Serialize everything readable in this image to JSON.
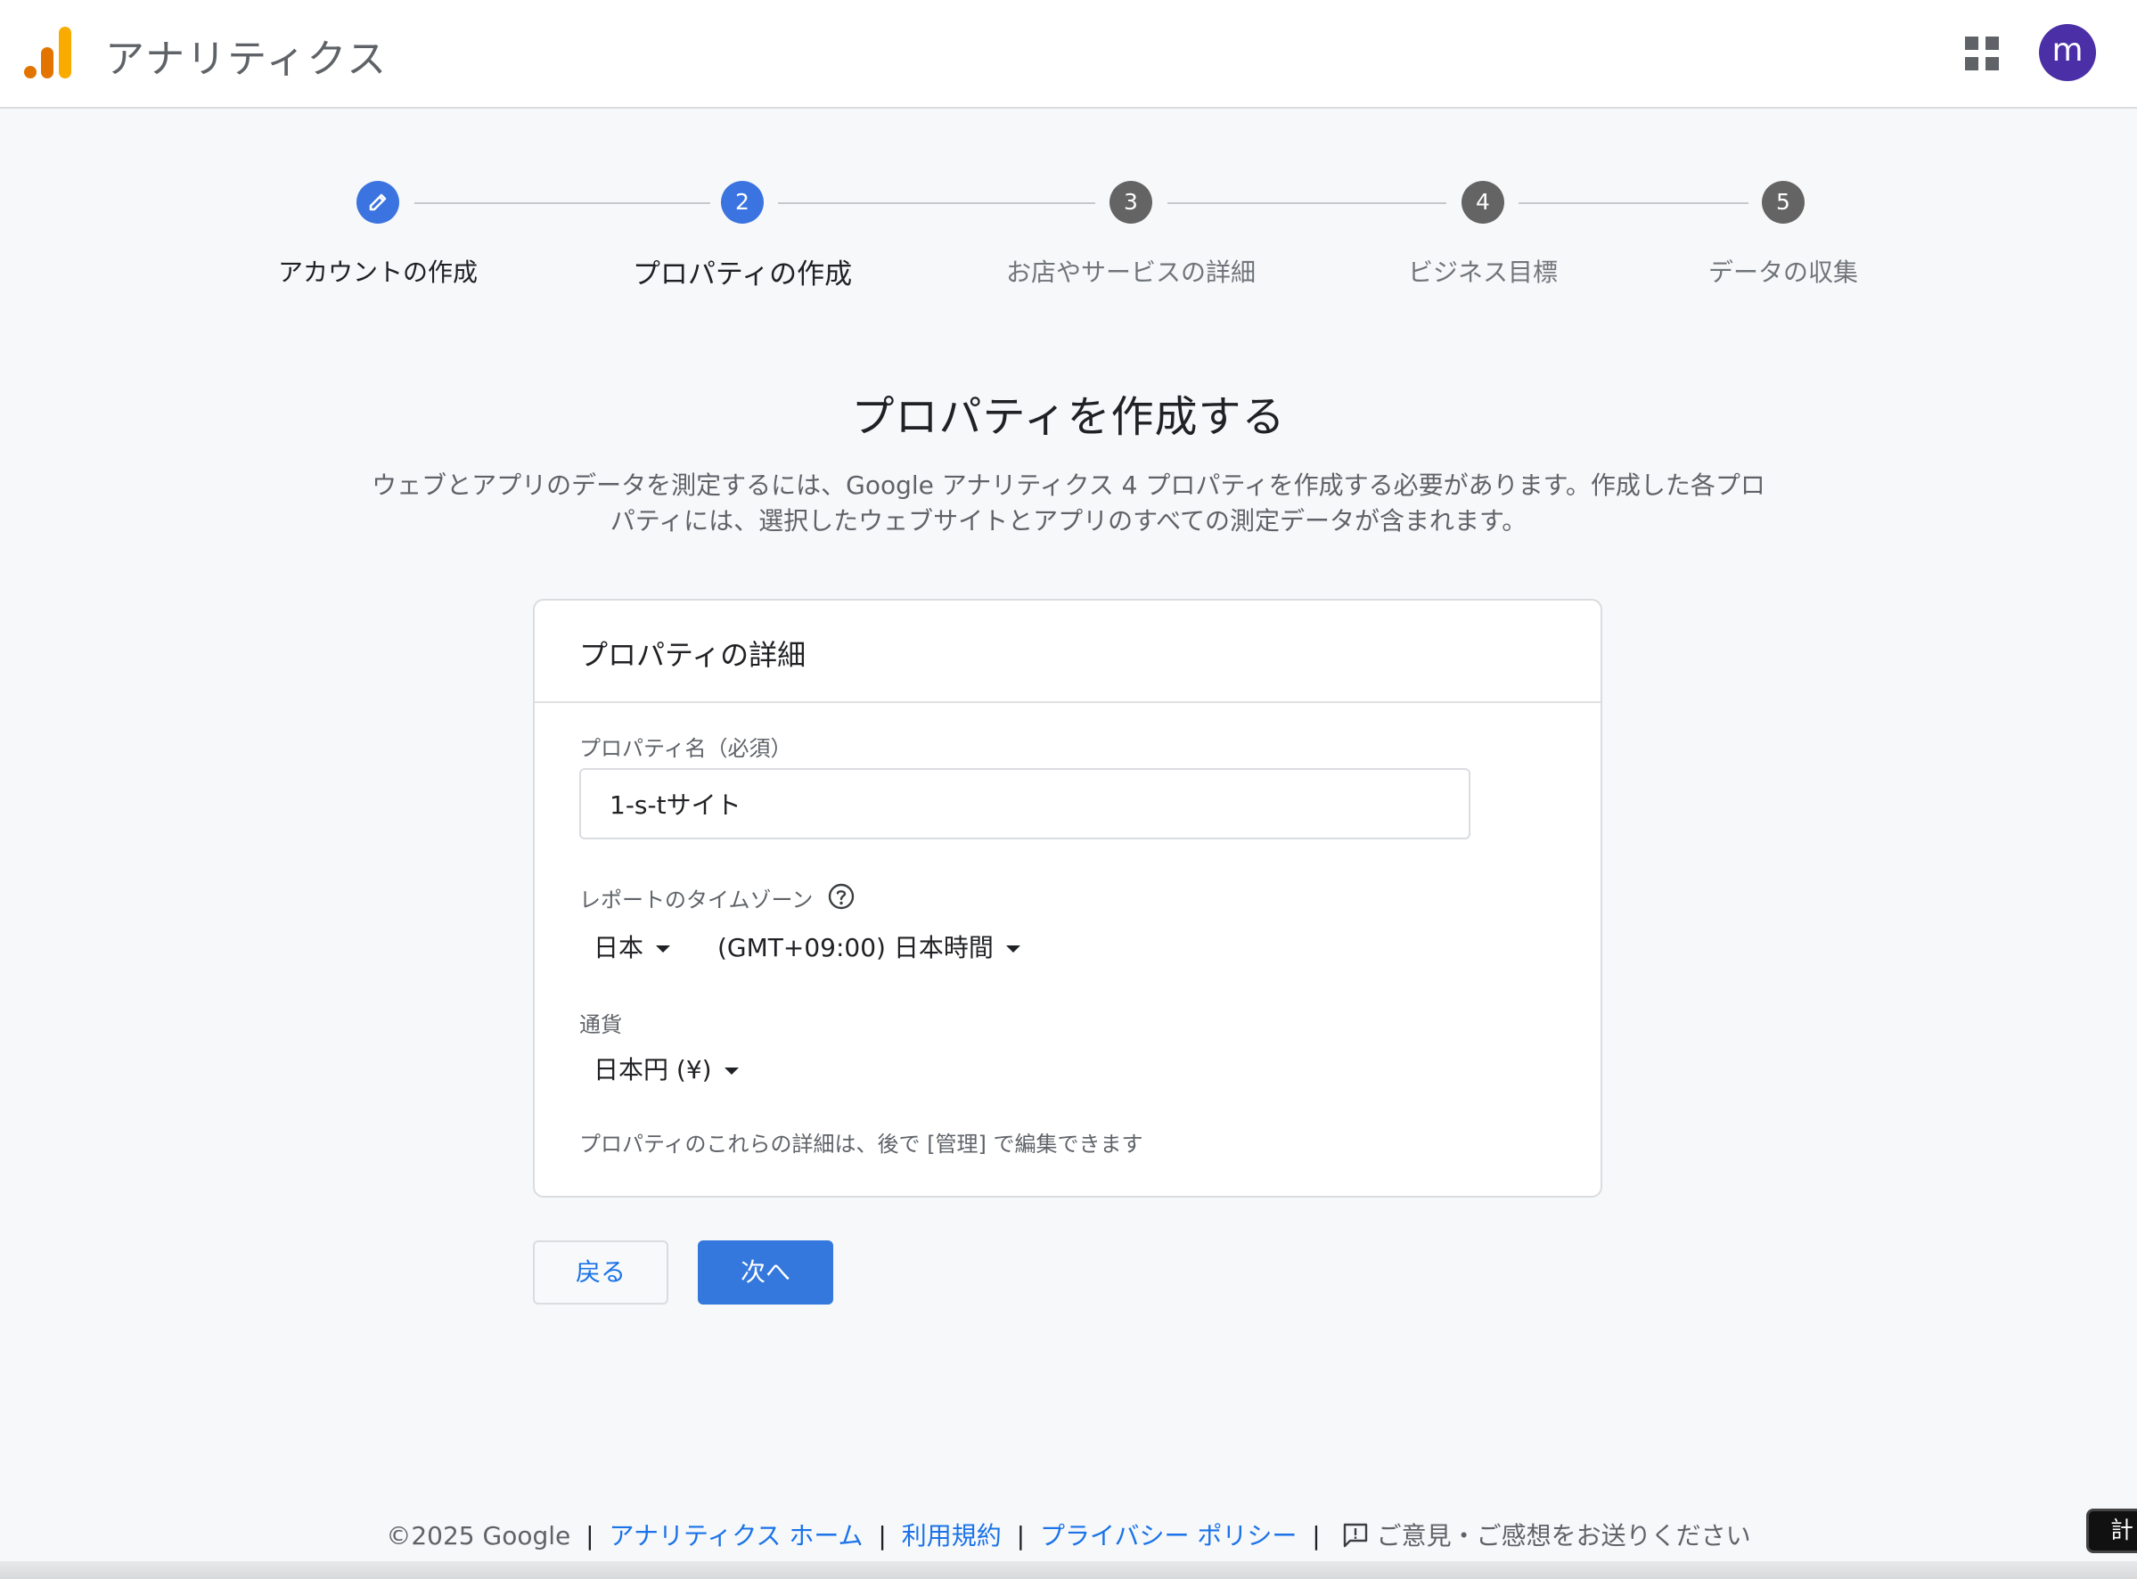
{
  "header": {
    "app_title": "アナリティクス",
    "apps_icon": "apps-grid-icon",
    "avatar_letter": "m",
    "avatar_color": "#4b2fa6"
  },
  "stepper": {
    "steps": [
      {
        "number": "",
        "label": "アカウントの作成",
        "state": "done",
        "icon": "pencil-icon"
      },
      {
        "number": "2",
        "label": "プロパティの作成",
        "state": "current"
      },
      {
        "number": "3",
        "label": "お店やサービスの詳細",
        "state": "pending"
      },
      {
        "number": "4",
        "label": "ビジネス目標",
        "state": "pending"
      },
      {
        "number": "5",
        "label": "データの収集",
        "state": "pending"
      }
    ]
  },
  "main": {
    "heading": "プロパティを作成する",
    "intro_line1": "ウェブとアプリのデータを測定するには、Google アナリティクス 4 プロパティを作成する必要があります。作成した各プロ",
    "intro_line2": "パティには、選択したウェブサイトとアプリのすべての測定データが含まれます。"
  },
  "card": {
    "title": "プロパティの詳細",
    "property_name_label": "プロパティ名（必須）",
    "property_name_value": "1-s-tサイト",
    "timezone_label": "レポートのタイムゾーン",
    "timezone_country": "日本",
    "timezone_value": "(GMT+09:00) 日本時間",
    "currency_label": "通貨",
    "currency_value": "日本円 (¥)",
    "note": "プロパティのこれらの詳細は、後で [管理] で編集できます"
  },
  "actions": {
    "back_label": "戻る",
    "next_label": "次へ"
  },
  "footer": {
    "copyright": "©2025 Google",
    "home_link": "アナリティクス ホーム",
    "terms_link": "利用規約",
    "privacy_link": "プライバシー ポリシー",
    "feedback": "ご意見・ご感想をお送りください",
    "separator": "|"
  },
  "corner_chip_text": "計"
}
